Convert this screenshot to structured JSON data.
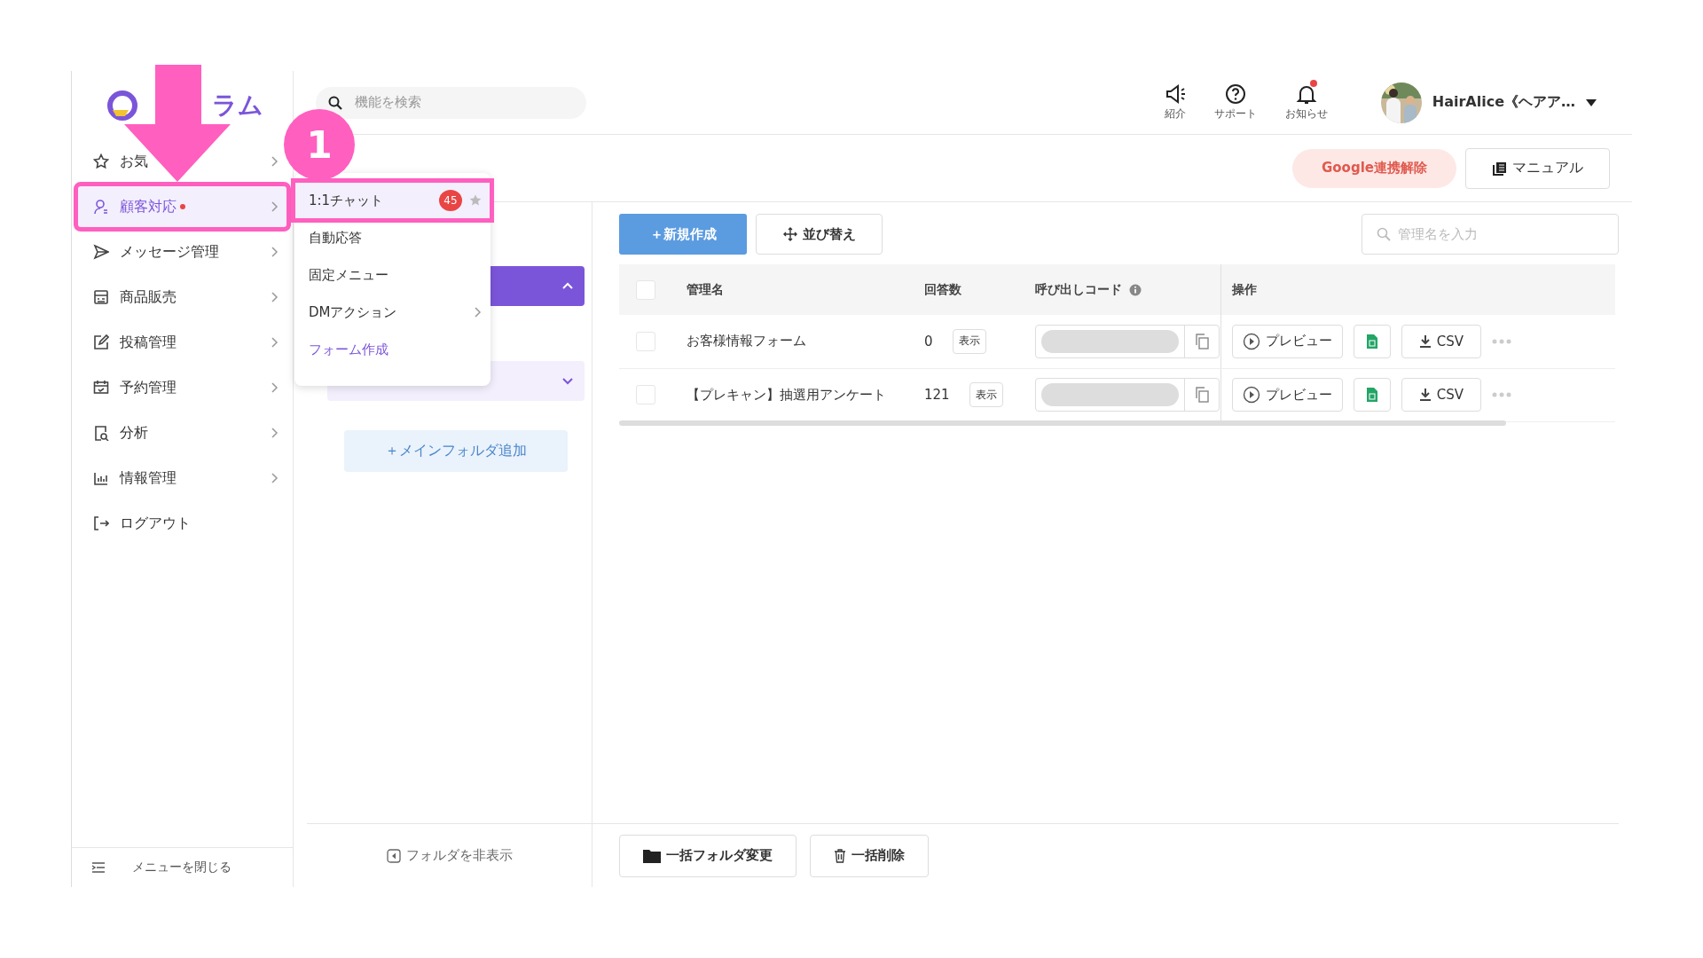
{
  "logo": {
    "text": "ラム"
  },
  "search": {
    "placeholder": "機能を検索"
  },
  "header_icons": [
    {
      "kind": "speaker",
      "label": "紹介",
      "alert": false
    },
    {
      "kind": "help",
      "label": "サポート",
      "alert": false
    },
    {
      "kind": "bell",
      "label": "お知らせ",
      "alert": true
    }
  ],
  "account": {
    "name": "HairAlice《ヘアア…"
  },
  "sidebar": {
    "items": [
      {
        "kind": "star",
        "label": "お気",
        "selected": false,
        "alert": false,
        "highlighted": false
      },
      {
        "kind": "person",
        "label": "顧客対応",
        "selected": true,
        "alert": true,
        "highlighted": true
      },
      {
        "kind": "send",
        "label": "メッセージ管理",
        "selected": false,
        "alert": false,
        "highlighted": false
      },
      {
        "kind": "shop",
        "label": "商品販売",
        "selected": false,
        "alert": false,
        "highlighted": false
      },
      {
        "kind": "edit",
        "label": "投稿管理",
        "selected": false,
        "alert": false,
        "highlighted": false
      },
      {
        "kind": "calendar",
        "label": "予約管理",
        "selected": false,
        "alert": false,
        "highlighted": false
      },
      {
        "kind": "report",
        "label": "分析",
        "selected": false,
        "alert": false,
        "highlighted": false
      },
      {
        "kind": "chart",
        "label": "情報管理",
        "selected": false,
        "alert": false,
        "highlighted": false
      },
      {
        "kind": "logout",
        "label": "ログアウト",
        "selected": false,
        "alert": false,
        "highlighted": false
      }
    ],
    "close_menu": "メニューを閉じる"
  },
  "submenu": [
    {
      "label": "1:1チャット",
      "hovered": true,
      "selected": false,
      "badge": "45",
      "starred": false,
      "arrow": false,
      "highlighted": true
    },
    {
      "label": "自動応答",
      "hovered": false,
      "selected": false,
      "arrow": false,
      "highlighted": false
    },
    {
      "label": "固定メニュー",
      "hovered": false,
      "selected": false,
      "arrow": false,
      "highlighted": false
    },
    {
      "label": "DMアクション",
      "hovered": false,
      "selected": false,
      "arrow": true,
      "highlighted": false
    },
    {
      "label": "フォーム作成",
      "hovered": false,
      "selected": true,
      "arrow": false,
      "highlighted": false
    }
  ],
  "annotation": {
    "step": "1"
  },
  "top_buttons": [
    {
      "kind": "danger",
      "label": "Google連携解除"
    },
    {
      "kind": "manual",
      "label": "マニュアル"
    }
  ],
  "folders": {
    "items": [
      {
        "expanded": true
      },
      {
        "expanded": false
      }
    ],
    "add_button": "＋メインフォルダ追加",
    "hide_button": "フォルダを非表示"
  },
  "toolbar": {
    "new_button": "＋新規作成",
    "sort_button": "並び替え",
    "search_placeholder": "管理名を入力"
  },
  "table": {
    "all_checked": false,
    "columns": [
      "管理名",
      "回答数",
      "呼び出しコード",
      "操作"
    ],
    "rows": [
      {
        "checked": false,
        "name": "お客様情報フォーム",
        "count": "0",
        "show": "表示",
        "preview": "プレビュー",
        "csv": "CSV"
      },
      {
        "checked": false,
        "name": "【プレキャン】抽選用アンケート",
        "count": "121",
        "show": "表示",
        "preview": "プレビュー",
        "csv": "CSV"
      }
    ]
  },
  "bulk_buttons": [
    {
      "kind": "folder",
      "label": "一括フォルダ変更"
    },
    {
      "kind": "delete",
      "label": "一括削除"
    }
  ]
}
